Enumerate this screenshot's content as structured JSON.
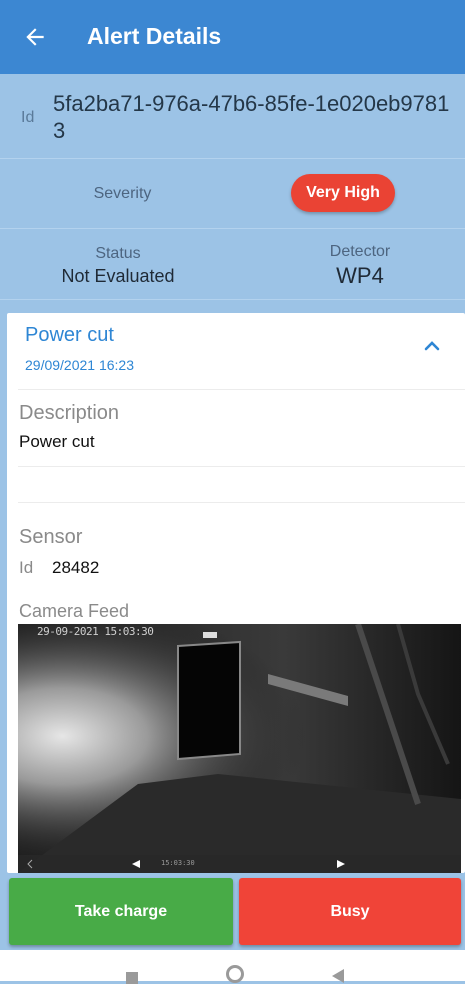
{
  "appbar": {
    "title": "Alert Details",
    "back_icon": "arrow-left-icon"
  },
  "alert": {
    "id_label": "Id",
    "id_value": "5fa2ba71-976a-47b6-85fe-1e020eb97813",
    "severity_label": "Severity",
    "severity_value": "Very High",
    "status_label": "Status",
    "status_value": "Not Evaluated",
    "detector_label": "Detector",
    "detector_value": "WP4"
  },
  "card": {
    "title": "Power cut",
    "datetime": "29/09/2021  16:23",
    "toggle_icon": "chevron-up-icon",
    "description_label": "Description",
    "description_value": "Power cut",
    "sensor_label": "Sensor",
    "sensor_id_label": "Id",
    "sensor_id_value": "28482",
    "camera_label": "Camera Feed",
    "camera_timestamp": "29-09-2021 15:03:30",
    "camera_time": "15:03:30"
  },
  "actions": {
    "take_charge": "Take charge",
    "busy": "Busy"
  },
  "colors": {
    "appbar": "#3c87d2",
    "background": "#9cc3e6",
    "severity_badge": "#ea4334",
    "take_charge": "#48ab47",
    "busy": "#f04438",
    "accent_text": "#2e86d4"
  },
  "navbar": {
    "icons": [
      "recents-square-icon",
      "home-circle-icon",
      "back-triangle-icon"
    ]
  }
}
